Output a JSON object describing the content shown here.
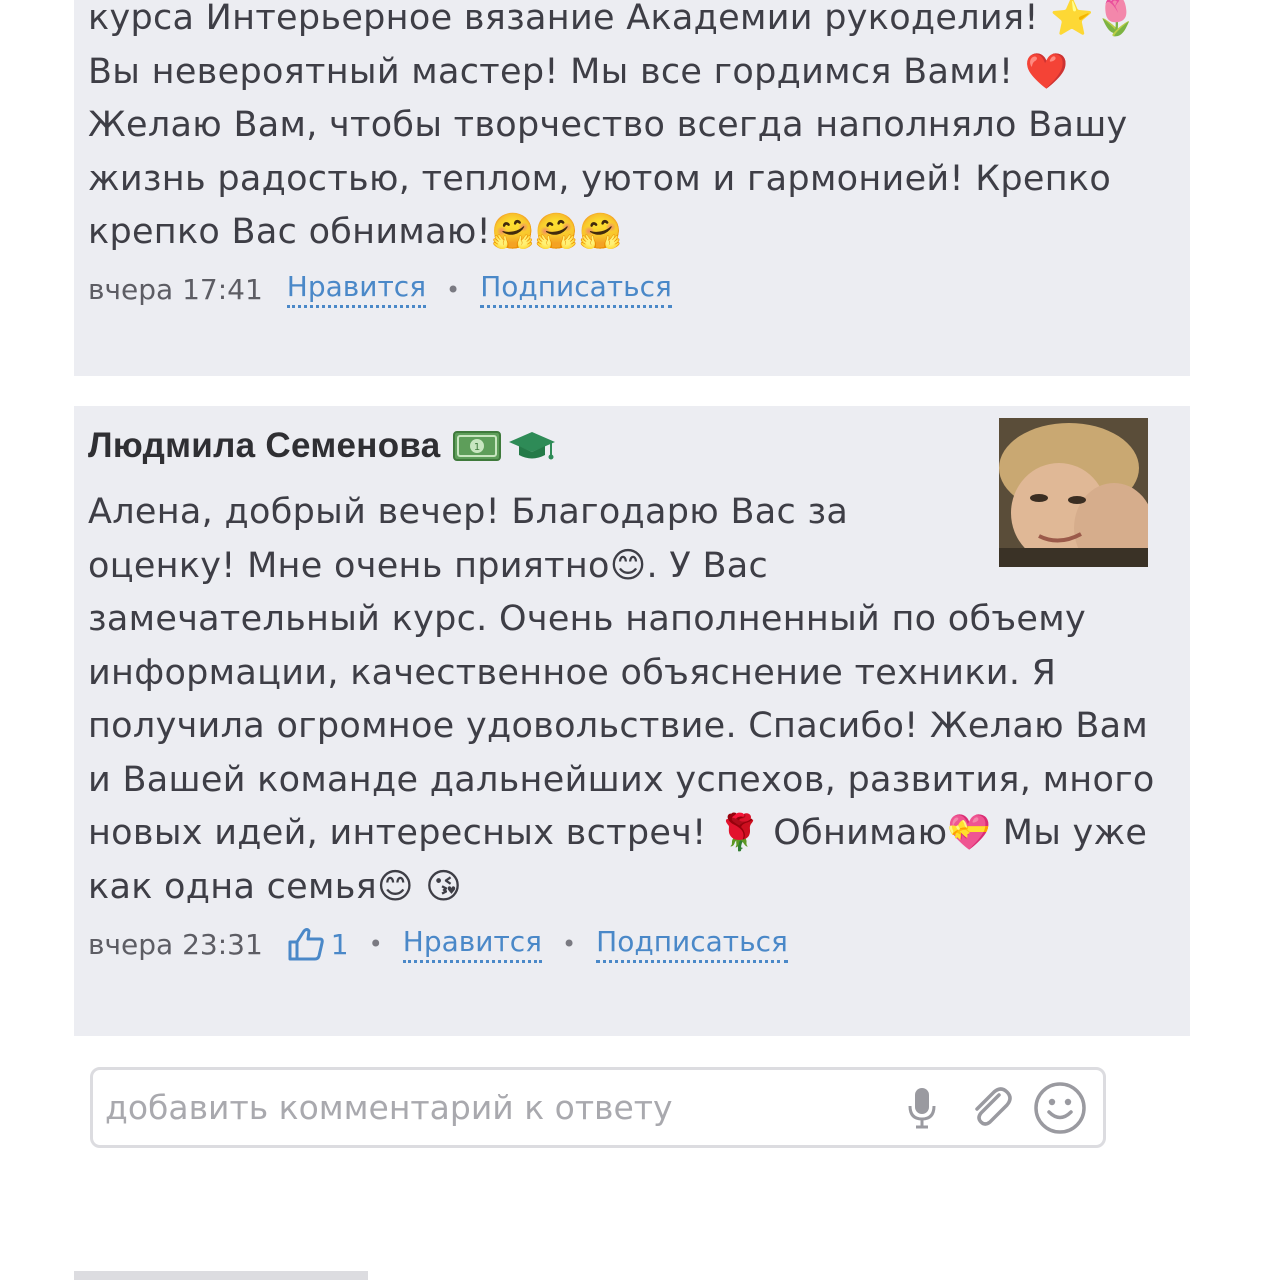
{
  "top_comment": {
    "lines": [
      "курса Интерьерное вязание Академии рукоделия! ⭐🌷",
      "Вы невероятный мастер! Мы все гордимся Вами! ❤️",
      "Желаю Вам, чтобы творчество всегда наполняло Вашу",
      "жизнь радостью, теплом, уютом и гармонией! Крепко",
      "крепко Вас обнимаю!🤗🤗🤗"
    ],
    "time": "вчера 17:41",
    "like_label": "Нравится",
    "separator": "•",
    "subscribe_label": "Подписаться"
  },
  "reply": {
    "author": "Людмила Семенова",
    "badges": [
      "💵",
      "🎓"
    ],
    "lines": [
      "Алена, добрый вечер! Благодарю Вас за",
      "оценку! Мне очень приятно😊. У Вас",
      "замечательный курс. Очень наполненный по объему",
      "информации, качественное объяснение техники. Я",
      "получила огромное удовольствие. Спасибо! Желаю Вам",
      "и Вашей команде дальнейших успехов, развития, много",
      "новых идей, интересных встреч! 🌹 Обнимаю💝 Мы уже",
      "как одна семья😊 😘"
    ],
    "time": "вчера 23:31",
    "like_count": "1",
    "like_label": "Нравится",
    "separator": "•",
    "subscribe_label": "Подписаться",
    "colors": {
      "link": "#4a88c8",
      "card_bg": "#ecedf2"
    }
  },
  "comment_box": {
    "placeholder": "добавить комментарий к ответу",
    "icons": [
      "microphone-icon",
      "paperclip-icon",
      "smiley-icon"
    ]
  }
}
